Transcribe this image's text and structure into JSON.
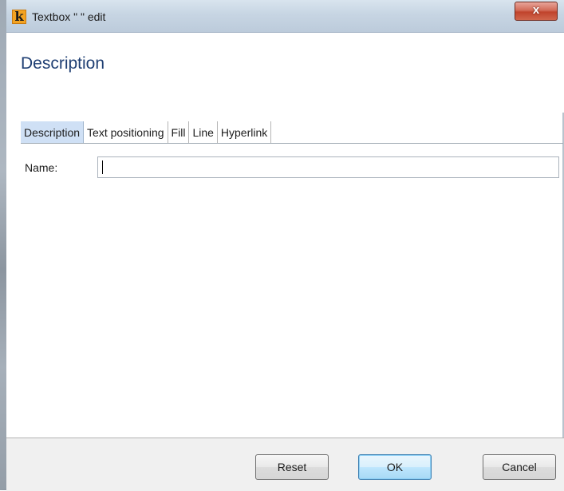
{
  "window": {
    "title": "Textbox \" \" edit",
    "close_label": "x",
    "icon": "k-app-icon",
    "icon_glyph": "k"
  },
  "header": {
    "title": "Description"
  },
  "tabs": [
    {
      "label": "Description",
      "active": true
    },
    {
      "label": "Text positioning",
      "active": false
    },
    {
      "label": "Fill",
      "active": false
    },
    {
      "label": "Line",
      "active": false
    },
    {
      "label": "Hyperlink",
      "active": false
    }
  ],
  "form": {
    "name_label": "Name:",
    "name_value": ""
  },
  "footer": {
    "reset_label": "Reset",
    "ok_label": "OK",
    "cancel_label": "Cancel"
  },
  "colors": {
    "accent_title": "#1f3f73",
    "active_tab": "#cfe0f5",
    "close_button": "#c0432c",
    "app_icon": "#f3a322"
  }
}
